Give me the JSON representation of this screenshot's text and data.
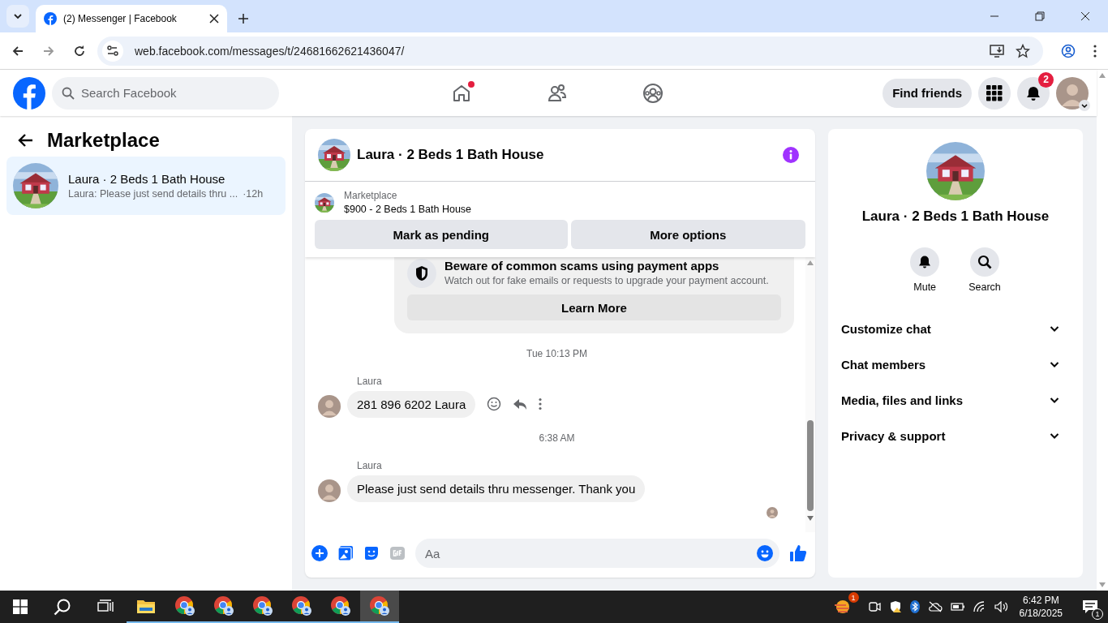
{
  "browser": {
    "tabs": [
      {
        "title": "(2) Messenger | Facebook",
        "selected": true
      }
    ],
    "url": "web.facebook.com/messages/t/24681662621436047/"
  },
  "topbar": {
    "search_placeholder": "Search Facebook",
    "nav": [
      {
        "kind": "home",
        "badge_dot": true
      },
      {
        "kind": "friends",
        "badge_dot": false
      },
      {
        "kind": "groups",
        "badge_dot": false
      }
    ],
    "find_friends": "Find friends",
    "notification_count": "2"
  },
  "sidebar": {
    "heading": "Marketplace",
    "conversations": [
      {
        "title": "Laura · 2 Beds 1 Bath House",
        "preview": "Laura: Please just send details thru ...",
        "time": "·12h",
        "selected": true
      }
    ]
  },
  "chat": {
    "title": "Laura · 2 Beds 1 Bath House",
    "listing": {
      "source": "Marketplace",
      "title": "$900 - 2 Beds 1 Bath House"
    },
    "actions": [
      "Mark as pending",
      "More options"
    ],
    "notice": {
      "title": "Beware of common scams using payment apps",
      "body": "Watch out for fake emails or requests to upgrade your payment account.",
      "button": "Learn More"
    },
    "messages": [
      {
        "kind": "timestamp",
        "text": "Tue 10:13 PM"
      },
      {
        "kind": "message",
        "sender": "Laura",
        "text": "281 896 6202 Laura",
        "show_actions": true
      },
      {
        "kind": "timestamp",
        "text": "6:38 AM"
      },
      {
        "kind": "message",
        "sender": "Laura",
        "text": "Please just send details thru messenger. Thank you",
        "show_actions": false
      }
    ],
    "composer_placeholder": "Aa"
  },
  "details": {
    "title": "Laura · 2 Beds 1 Bath House",
    "actions": [
      {
        "kind": "mute",
        "label": "Mute"
      },
      {
        "kind": "search",
        "label": "Search"
      }
    ],
    "sections": [
      {
        "label": "Customize chat",
        "expanded": false
      },
      {
        "label": "Chat members",
        "expanded": false
      },
      {
        "label": "Media, files and links",
        "expanded": false
      },
      {
        "label": "Privacy & support",
        "expanded": false
      }
    ]
  },
  "taskbar": {
    "apps": [
      {
        "kind": "explorer",
        "selected": false
      },
      {
        "kind": "chrome",
        "selected": false
      },
      {
        "kind": "chrome",
        "selected": false
      },
      {
        "kind": "chrome",
        "selected": false
      },
      {
        "kind": "chrome",
        "selected": false
      },
      {
        "kind": "chrome",
        "selected": false
      },
      {
        "kind": "chrome",
        "selected": true
      }
    ],
    "weather_badge": "1",
    "time": "6:42 PM",
    "date": "6/18/2025",
    "notifications": "1"
  }
}
